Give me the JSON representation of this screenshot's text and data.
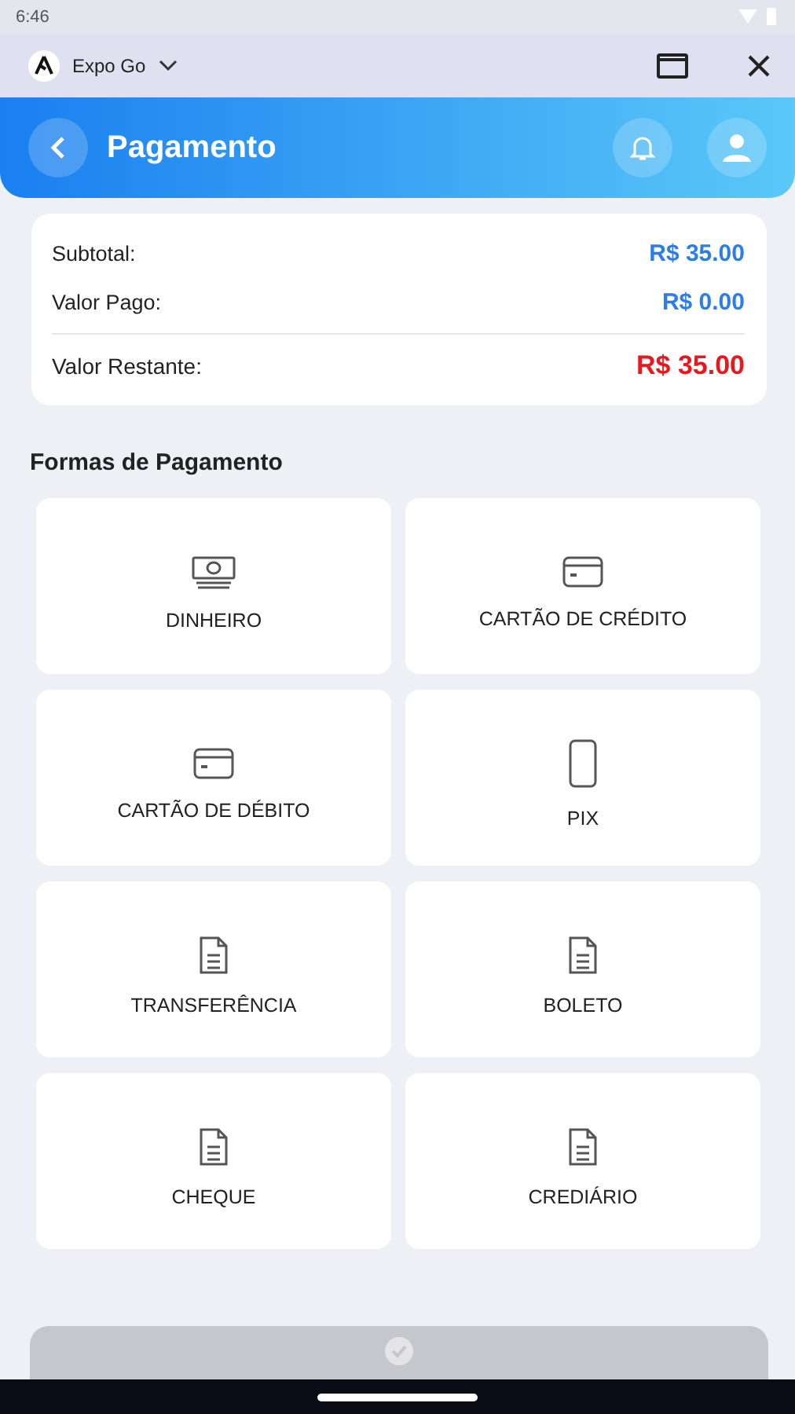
{
  "status_bar": {
    "time": "6:46"
  },
  "app_bar": {
    "app_name": "Expo Go"
  },
  "header": {
    "title": "Pagamento"
  },
  "summary": [
    {
      "label": "Subtotal:",
      "value": "R$ 35.00",
      "color": "#2b7de9",
      "kind": "line"
    },
    {
      "label": "Valor Pago:",
      "value": "R$ 0.00",
      "color": "#2b7de9",
      "kind": "line"
    },
    {
      "label": "Valor Restante:",
      "value": "R$ 35.00",
      "color": "#e8191e",
      "kind": "total"
    }
  ],
  "methods_title": "Formas de Pagamento",
  "methods": [
    {
      "label": "DINHEIRO",
      "kind": "cash"
    },
    {
      "label": "CARTÃO DE CRÉDITO",
      "kind": "card"
    },
    {
      "label": "CARTÃO DE DÉBITO",
      "kind": "card"
    },
    {
      "label": "PIX",
      "kind": "phone"
    },
    {
      "label": "TRANSFERÊNCIA",
      "kind": "document"
    },
    {
      "label": "BOLETO",
      "kind": "document"
    },
    {
      "label": "CHEQUE",
      "kind": "document"
    },
    {
      "label": "CREDIÁRIO",
      "kind": "document"
    }
  ],
  "confirm_button": {
    "disabled": true
  }
}
